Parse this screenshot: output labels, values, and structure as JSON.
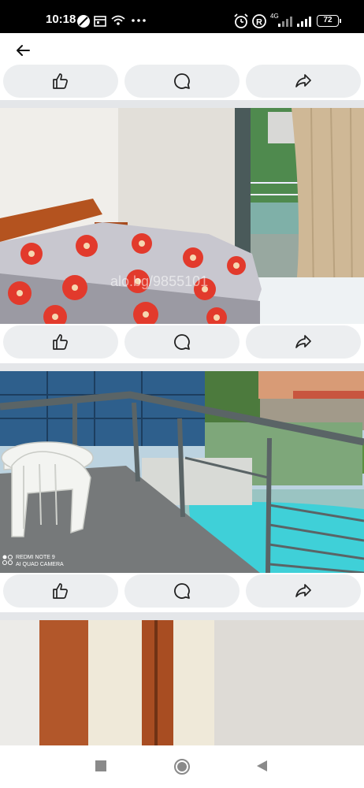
{
  "status_bar": {
    "time": "10:18",
    "network": "4G",
    "battery": "72"
  },
  "app_bar": {
    "back_icon": "arrow-left-icon"
  },
  "posts": [
    {
      "photo": "apartment-bedroom",
      "watermark": "alo.bg/9855101"
    },
    {
      "photo": "balcony-pool-view",
      "camera_caption_1": "REDMI NOTE 9",
      "camera_caption_2": "AI QUAD CAMERA"
    },
    {
      "photo": "wardrobe-doors"
    }
  ],
  "actions": {
    "like_icon": "thumbs-up-icon",
    "comment_icon": "comment-icon",
    "share_icon": "share-icon"
  },
  "nav": {
    "recent_icon": "square-icon",
    "home_icon": "circle-icon",
    "back_icon": "triangle-back-icon"
  },
  "colors": {
    "pill": "#eceef0",
    "separator": "#e4e6e9",
    "pool": "#3fd0d8"
  }
}
